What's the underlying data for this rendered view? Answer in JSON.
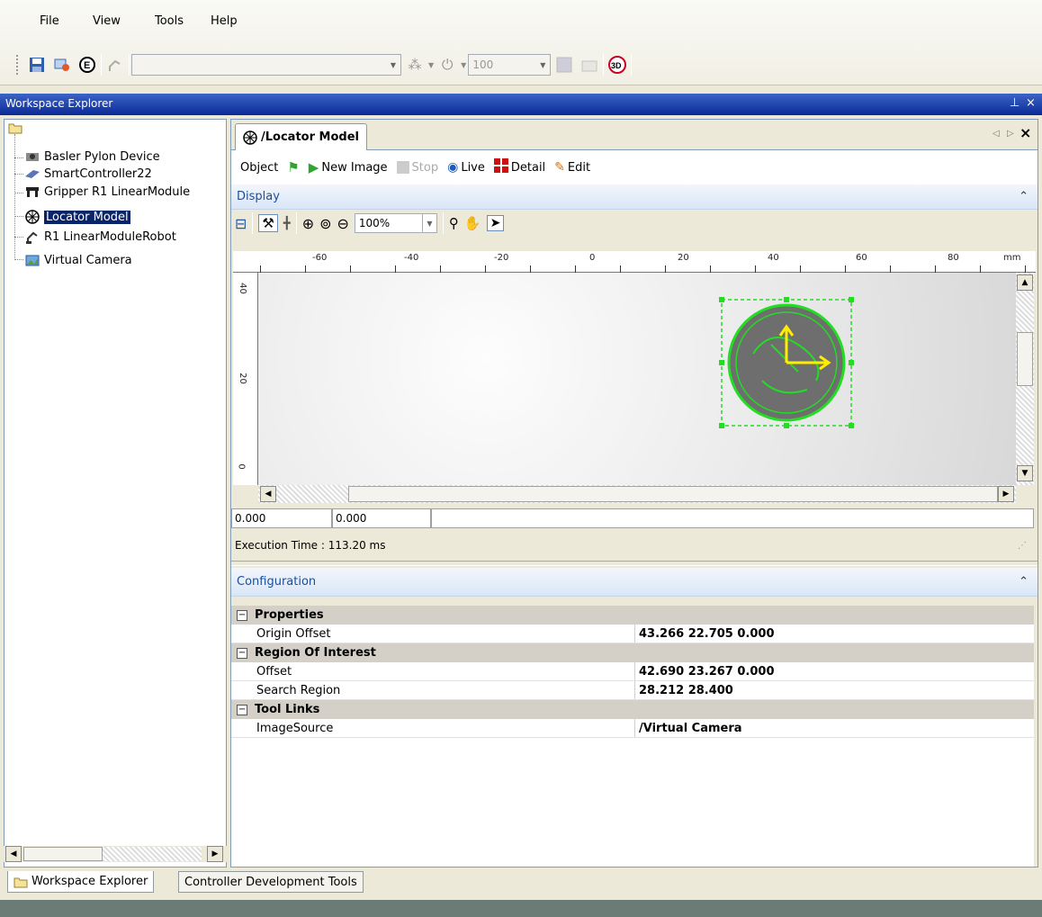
{
  "menu": [
    "File",
    "View",
    "Tools",
    "Help"
  ],
  "toolbar": {
    "zoom_value": "100"
  },
  "workspace": {
    "title": "Workspace Explorer"
  },
  "tree": [
    {
      "label": "Basler Pylon Device",
      "icon": "camera-device-icon"
    },
    {
      "label": "SmartController22",
      "icon": "controller-icon"
    },
    {
      "label": "Gripper R1 LinearModule",
      "icon": "gripper-icon"
    },
    {
      "label": "Locator Model",
      "icon": "locator-model-icon",
      "selected": true
    },
    {
      "label": "R1 LinearModuleRobot",
      "icon": "robot-icon"
    },
    {
      "label": "Virtual Camera",
      "icon": "virtual-camera-icon"
    }
  ],
  "editor": {
    "tab_label": "/Locator Model",
    "toolbar": {
      "object": "Object",
      "new_image": "New Image",
      "stop": "Stop",
      "live": "Live",
      "detail": "Detail",
      "edit": "Edit"
    },
    "display_header": "Display",
    "zoom": "100%",
    "ruler_h": [
      "-60",
      "-40",
      "-20",
      "0",
      "20",
      "40",
      "60",
      "80",
      "mm"
    ],
    "ruler_v": [
      "40",
      "20",
      "0"
    ],
    "coord_x": "0.000",
    "coord_y": "0.000",
    "execution_time": "Execution Time : 113.20 ms",
    "config_header": "Configuration"
  },
  "properties": [
    {
      "category": "Properties",
      "rows": [
        {
          "key": "Origin Offset",
          "value": "43.266 22.705 0.000"
        }
      ]
    },
    {
      "category": "Region Of Interest",
      "rows": [
        {
          "key": "Offset",
          "value": "42.690 23.267 0.000"
        },
        {
          "key": "Search Region",
          "value": "28.212 28.400"
        }
      ]
    },
    {
      "category": "Tool Links",
      "rows": [
        {
          "key": "ImageSource",
          "value": "/Virtual Camera"
        }
      ]
    }
  ],
  "bottom_tabs": [
    "Workspace Explorer",
    "Controller Development Tools"
  ],
  "colors": {
    "header_blue": "#0a2a96",
    "selection": "#0a246a",
    "model_green": "#22dd22",
    "axis_yellow": "#ffee00"
  }
}
